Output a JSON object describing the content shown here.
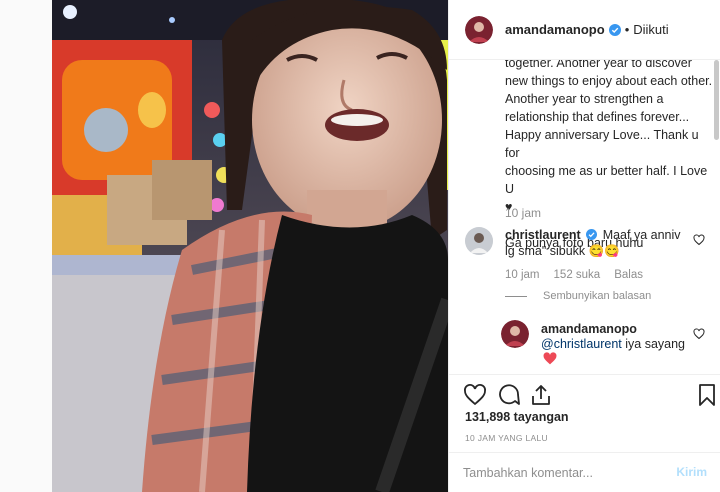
{
  "post": {
    "author": "amandamanopo",
    "follow_separator": "•",
    "follow_status": "Diikuti",
    "caption": "together. Another year to discover\nnew things to enjoy about each other.\nAnother year to strengthen a\nrelationship that defines forever...\nHappy anniversary Love... Thank u for\nchoosing me as ur better half. I Love U\n♥\n\nGa punya foto baru huhu",
    "caption_time": "10 jam"
  },
  "comments": [
    {
      "user": "christlaurent",
      "text": "Maaf ya anniv lg sma\" sibukk 😋😋",
      "time": "10 jam",
      "likes": "152 suka",
      "reply_label": "Balas",
      "hide_replies": "Sembunyikan balasan"
    }
  ],
  "reply": {
    "user": "amandamanopo",
    "mention": "@christlaurent",
    "text": " iya sayang"
  },
  "stats": {
    "views": "131,898",
    "views_label": "tayangan",
    "posted": "10 JAM YANG LALU"
  },
  "composer": {
    "placeholder": "Tambahkan komentar...",
    "post_label": "Kirim"
  },
  "icons": {
    "like": "heart-icon",
    "comment": "comment-icon",
    "share": "share-icon",
    "save": "bookmark-icon",
    "verified": "verified-badge-icon"
  },
  "colors": {
    "verified": "#3897f0",
    "reply_heart": "#ed4956",
    "post_button_disabled": "#b2dffc"
  }
}
